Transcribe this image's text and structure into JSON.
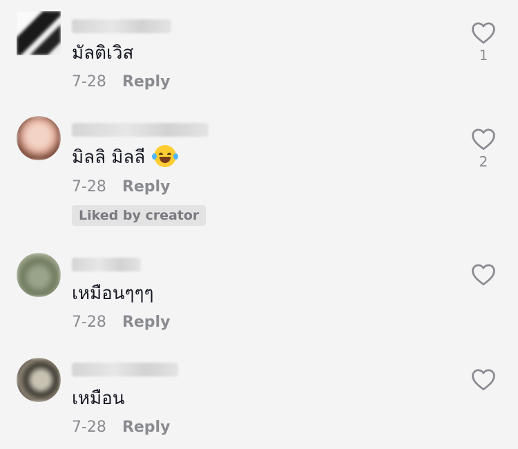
{
  "comments": [
    {
      "text": "มัลติเวิส",
      "date": "7-28",
      "reply_label": "Reply",
      "like_count": "1"
    },
    {
      "text": "มิลลิ มิลลี",
      "emoji": "face-with-tears-of-joy",
      "date": "7-28",
      "reply_label": "Reply",
      "badge": "Liked by creator",
      "like_count": "2"
    },
    {
      "text": "เหมือนๆๆๆ",
      "date": "7-28",
      "reply_label": "Reply",
      "like_count": ""
    },
    {
      "text": "เหมือน",
      "date": "7-28",
      "reply_label": "Reply",
      "like_count": ""
    }
  ],
  "icons": {
    "like": "heart-outline-icon"
  },
  "colors": {
    "background": "#f4f4f4",
    "text": "#161823",
    "meta": "#8a8b91",
    "badge_bg": "#e3e3e4"
  }
}
